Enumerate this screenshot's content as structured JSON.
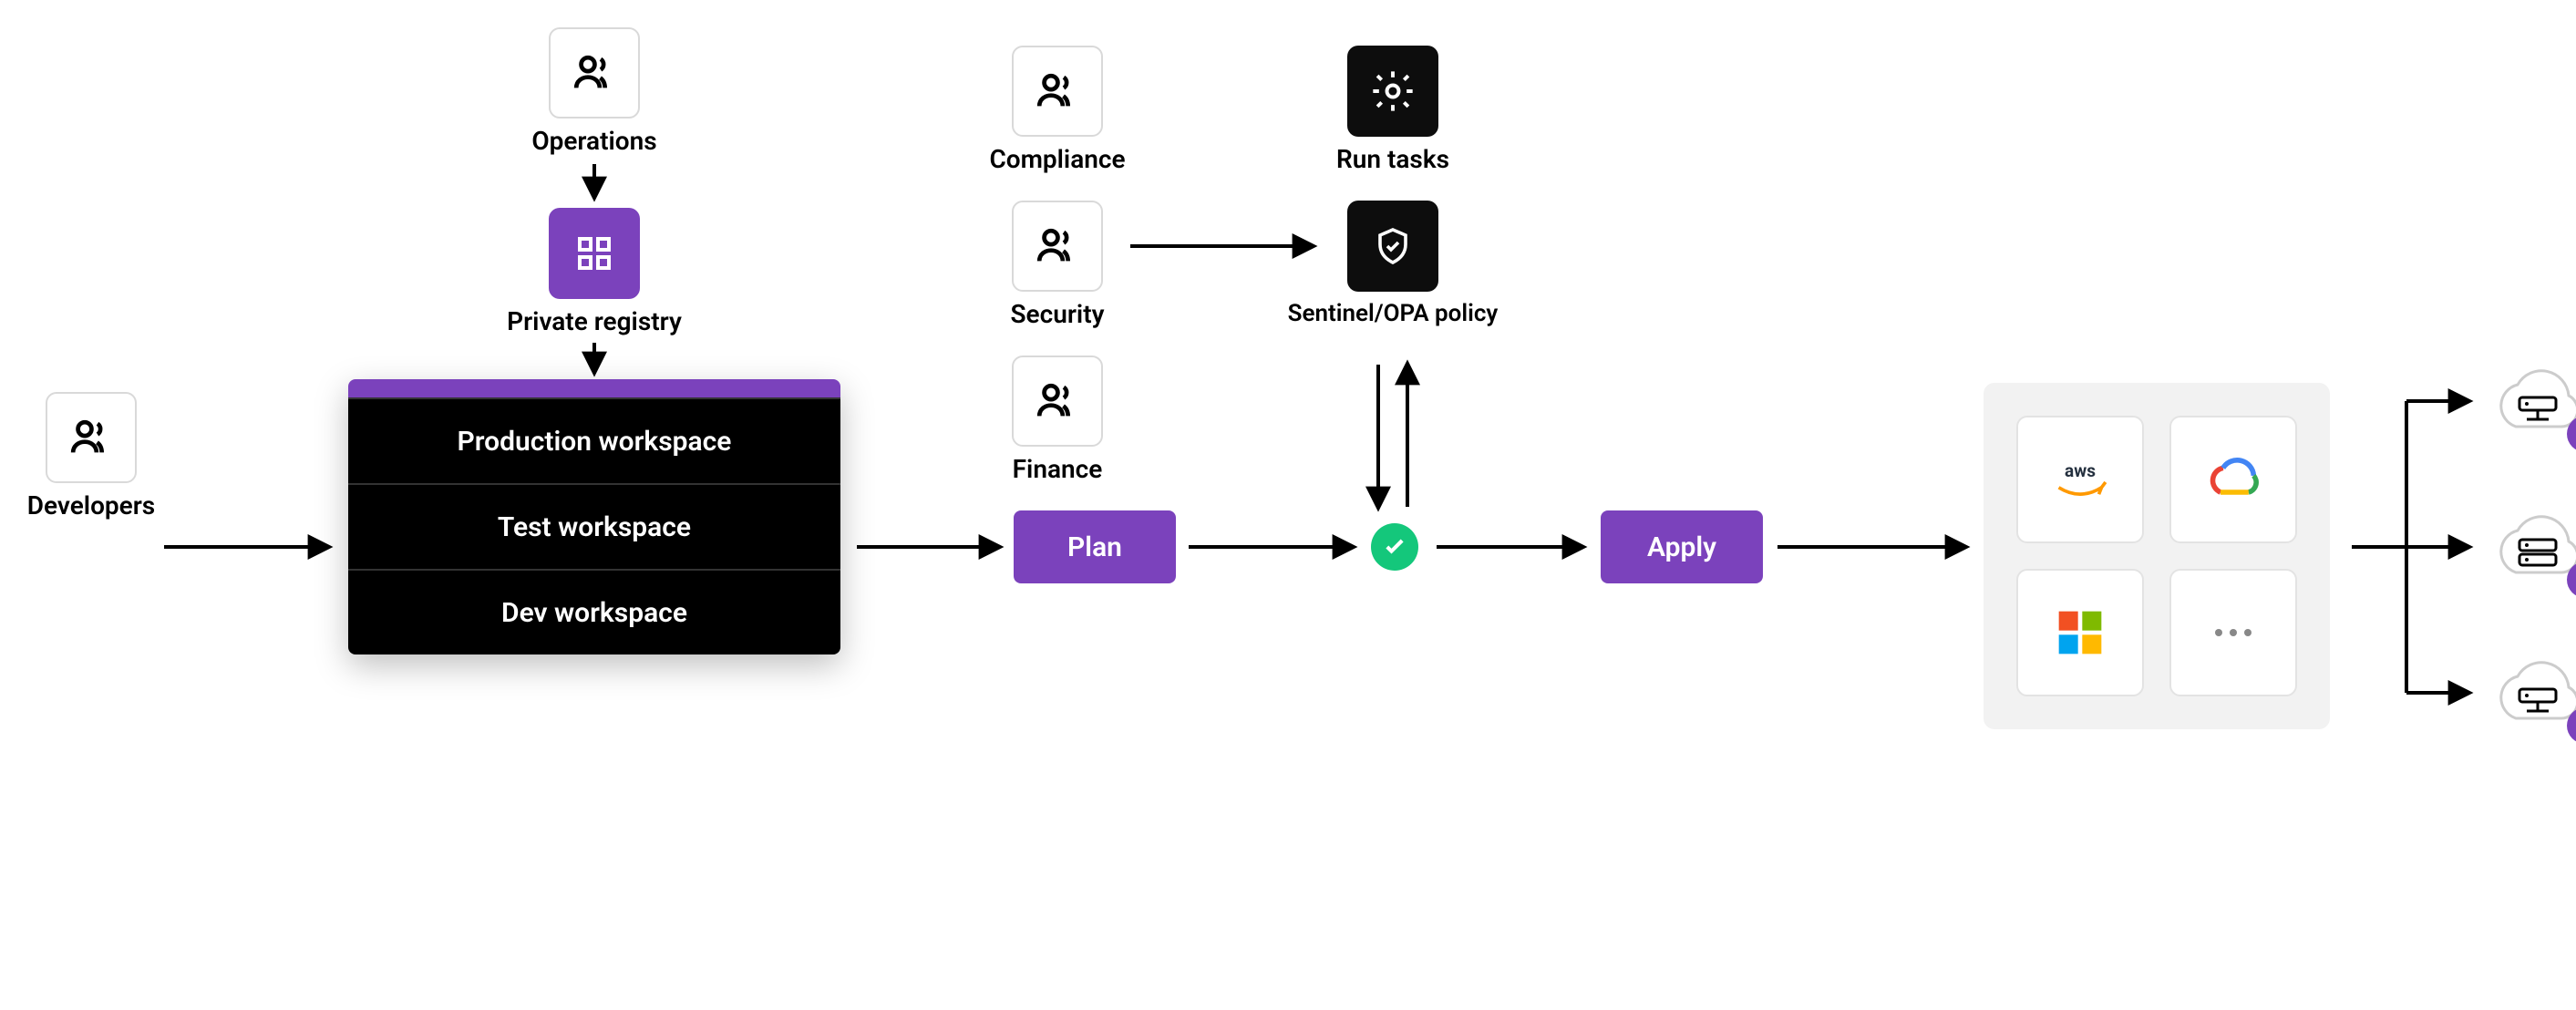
{
  "roles": {
    "developers": "Developers",
    "operations": "Operations",
    "compliance": "Compliance",
    "security": "Security",
    "finance": "Finance"
  },
  "registry": {
    "label": "Private registry"
  },
  "workspaces": {
    "production": "Production workspace",
    "test": "Test workspace",
    "dev": "Dev workspace"
  },
  "stages": {
    "plan": "Plan",
    "apply": "Apply"
  },
  "policy": {
    "run_tasks": "Run tasks",
    "sentinel": "Sentinel/OPA policy"
  },
  "providers": {
    "aws": "aws",
    "gcp": "Google Cloud",
    "azure": "Microsoft",
    "more": "…"
  },
  "colors": {
    "purple": "#7b42bc",
    "green": "#14c77b",
    "dark": "#0d0d0d"
  }
}
